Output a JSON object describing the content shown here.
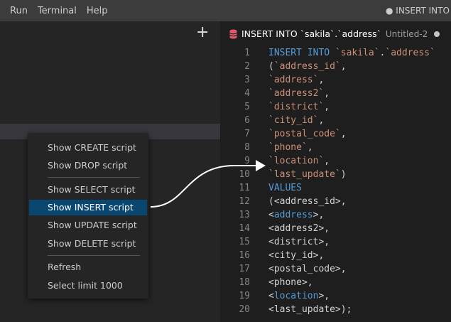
{
  "menubar": {
    "items": [
      "Run",
      "Terminal",
      "Help"
    ],
    "window_title": "● INSERT INTO `sa"
  },
  "sidebar": {
    "plus_label": "+"
  },
  "tab": {
    "title": "INSERT INTO `sakila`.`address`",
    "subtitle": "Untitled-2"
  },
  "context_menu": {
    "items": [
      "Show CREATE script",
      "Show DROP script",
      "Show SELECT script",
      "Show INSERT script",
      "Show UPDATE script",
      "Show DELETE script",
      "Refresh",
      "Select limit 1000"
    ],
    "active": "Show INSERT script"
  },
  "editor": {
    "lines": [
      [
        [
          "kw",
          "INSERT INTO "
        ],
        [
          "str",
          "`sakila`"
        ],
        [
          "pl",
          "."
        ],
        [
          "str",
          "`address`"
        ]
      ],
      [
        [
          "pl",
          "("
        ],
        [
          "str",
          "`address_id`"
        ],
        [
          "pl",
          ","
        ]
      ],
      [
        [
          "str",
          "`address`"
        ],
        [
          "pl",
          ","
        ]
      ],
      [
        [
          "str",
          "`address2`"
        ],
        [
          "pl",
          ","
        ]
      ],
      [
        [
          "str",
          "`district`"
        ],
        [
          "pl",
          ","
        ]
      ],
      [
        [
          "str",
          "`city_id`"
        ],
        [
          "pl",
          ","
        ]
      ],
      [
        [
          "str",
          "`postal_code`"
        ],
        [
          "pl",
          ","
        ]
      ],
      [
        [
          "str",
          "`phone`"
        ],
        [
          "pl",
          ","
        ]
      ],
      [
        [
          "str",
          "`location`"
        ],
        [
          "pl",
          ","
        ]
      ],
      [
        [
          "str",
          "`last_update`"
        ],
        [
          "pl",
          ")"
        ]
      ],
      [
        [
          "kw",
          "VALUES"
        ]
      ],
      [
        [
          "pl",
          "(<address_id>,"
        ]
      ],
      [
        [
          "pl",
          "<"
        ],
        [
          "kw",
          "address"
        ],
        [
          "pl",
          ">,"
        ]
      ],
      [
        [
          "pl",
          "<address2>,"
        ]
      ],
      [
        [
          "pl",
          "<district>,"
        ]
      ],
      [
        [
          "pl",
          "<city_id>,"
        ]
      ],
      [
        [
          "pl",
          "<postal_code>,"
        ]
      ],
      [
        [
          "pl",
          "<phone>,"
        ]
      ],
      [
        [
          "pl",
          "<"
        ],
        [
          "kw",
          "location"
        ],
        [
          "pl",
          ">,"
        ]
      ],
      [
        [
          "pl",
          "<last_update>);"
        ]
      ]
    ]
  },
  "colors": {
    "menubar_bg": "#3c3c3c",
    "editor_bg": "#1e1e1e",
    "sidebar_bg": "#252526",
    "menu_active": "#094771",
    "keyword": "#569cd6",
    "string": "#ce9178",
    "db_icon": "#e05a6f"
  }
}
